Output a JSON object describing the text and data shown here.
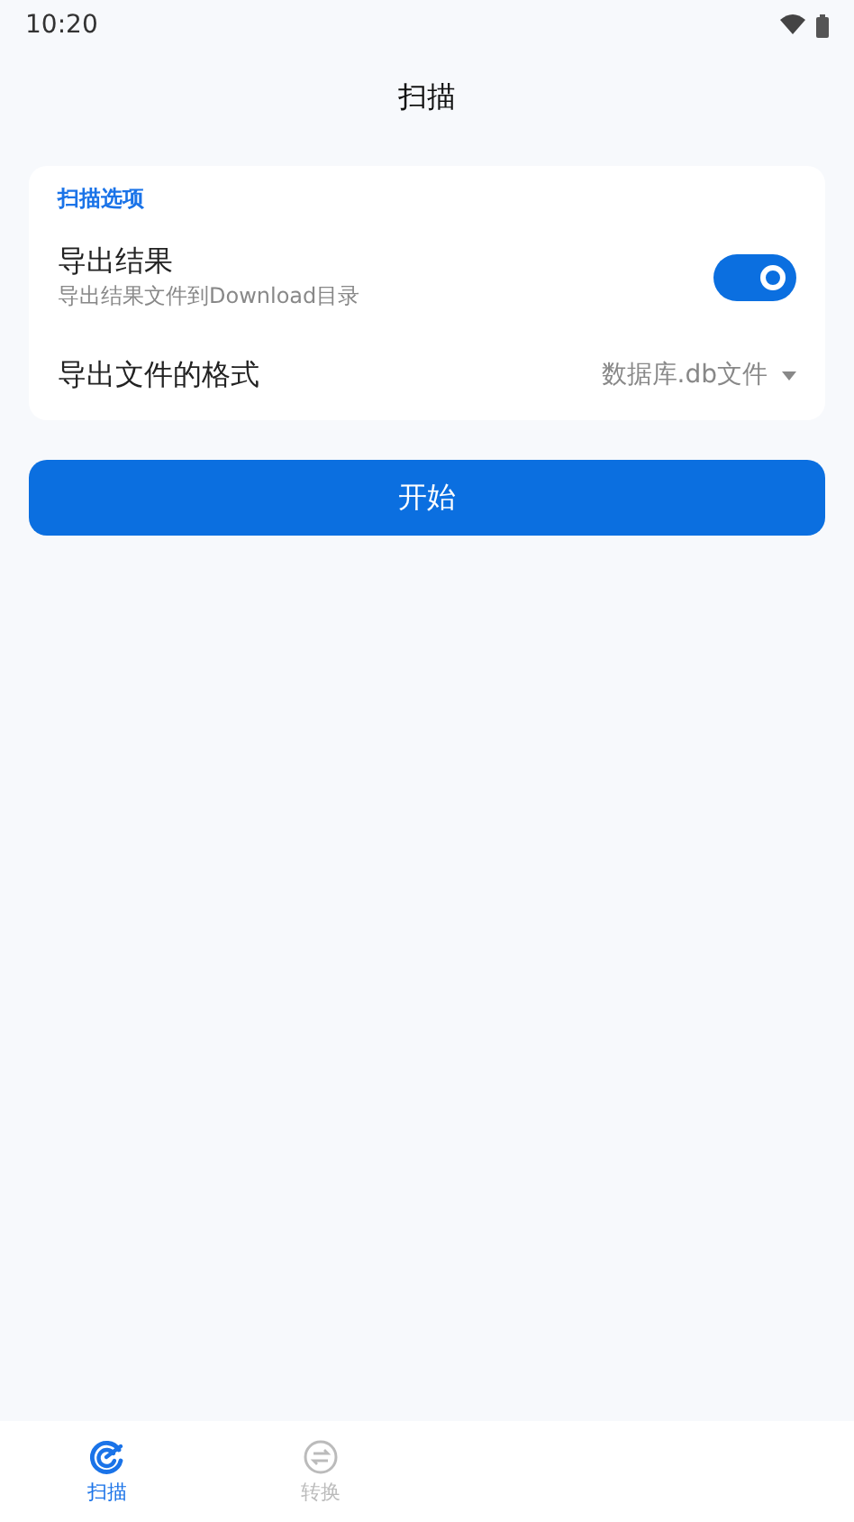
{
  "status_bar": {
    "time": "10:20"
  },
  "title": "扫描",
  "section": {
    "title": "扫描选项",
    "rows": [
      {
        "kind": "switch",
        "label": "导出结果",
        "subtitle": "导出结果文件到Download目录",
        "on": true
      },
      {
        "kind": "dropdown",
        "label": "导出文件的格式",
        "value": "数据库.db文件"
      }
    ]
  },
  "start_button": "开始",
  "tabs": [
    {
      "label": "扫描",
      "kind": "scan",
      "selected": true
    },
    {
      "label": "转换",
      "kind": "convert",
      "selected": false
    }
  ]
}
